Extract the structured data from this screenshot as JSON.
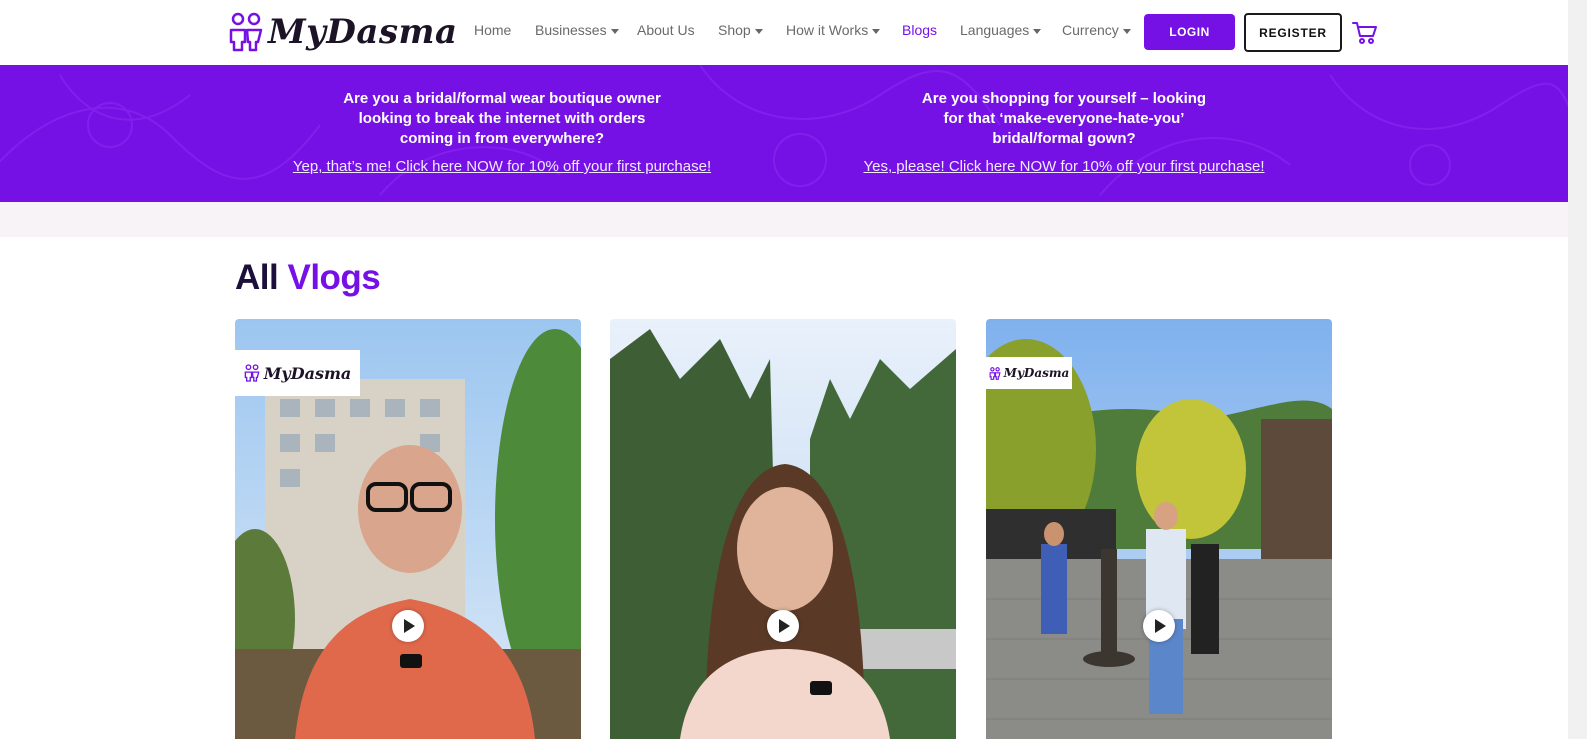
{
  "brand": {
    "name": "MyDasma"
  },
  "nav": {
    "items": [
      {
        "label": "Home",
        "dropdown": false,
        "active": false
      },
      {
        "label": "Businesses",
        "dropdown": true,
        "active": false
      },
      {
        "label": "About Us",
        "dropdown": false,
        "active": false
      },
      {
        "label": "Shop",
        "dropdown": true,
        "active": false
      },
      {
        "label": "How it Works",
        "dropdown": true,
        "active": false
      },
      {
        "label": "Blogs",
        "dropdown": false,
        "active": true
      },
      {
        "label": "Languages",
        "dropdown": true,
        "active": false
      },
      {
        "label": "Currency",
        "dropdown": true,
        "active": false
      }
    ],
    "login_label": "LOGIN",
    "register_label": "REGISTER",
    "cart_icon": "cart-icon"
  },
  "promo": {
    "business": {
      "question": "Are you a bridal/formal wear boutique owner\nlooking to break the internet with orders\ncoming in from everywhere?",
      "link": "Yep, that’s me! Click here NOW for 10% off your first purchase!"
    },
    "shopper": {
      "question": "Are you shopping for yourself – looking\nfor that ‘make-everyone-hate-you’\nbridal/formal gown?",
      "link": "Yes, please! Click here NOW for 10% off your first purchase!"
    }
  },
  "vlogs": {
    "title_main": "All",
    "title_accent": "Vlogs",
    "cards": [
      {
        "watermark": "MyDasma"
      },
      {
        "watermark": ""
      },
      {
        "watermark": "MyDasma"
      }
    ]
  },
  "colors": {
    "brand_purple": "#7611e6",
    "title_dark": "#1c0f3c",
    "strip_bg": "#f7f3f7"
  }
}
